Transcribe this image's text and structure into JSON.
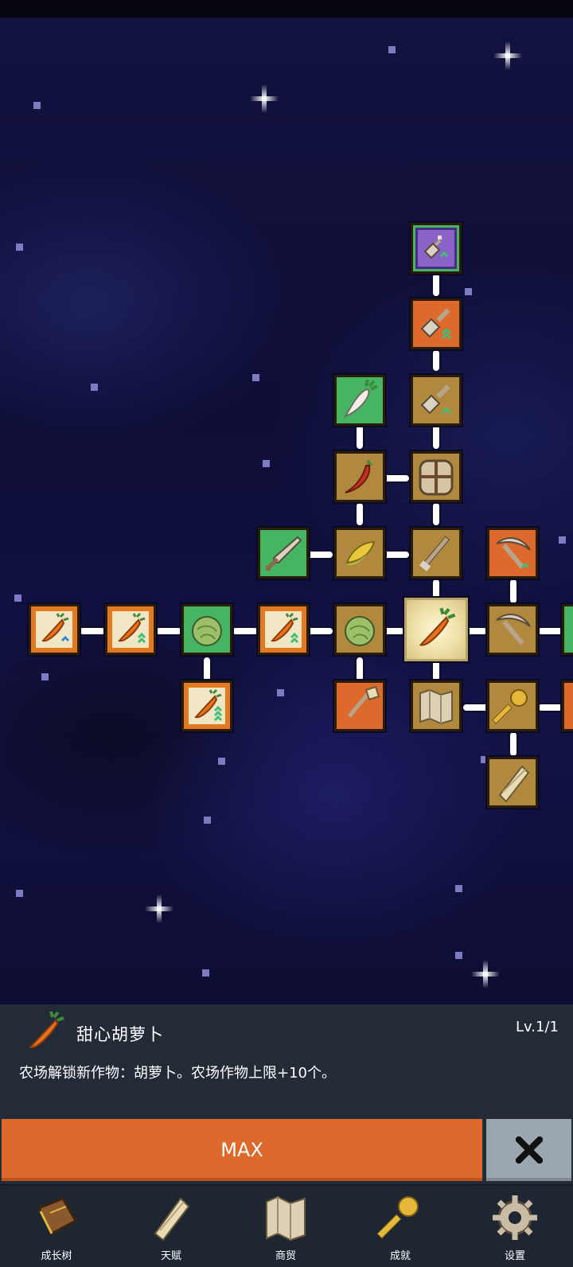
{
  "game": {
    "screen": "skill-tree",
    "selected_skill": {
      "name": "甜心胡萝卜",
      "level": "Lv.1/1",
      "description": "农场解锁新作物：胡萝卜。农场作物上限+10个。",
      "icon": "carrot-icon"
    },
    "max_button_label": "MAX",
    "close_button_icon": "close-icon"
  },
  "tree_nodes": [
    {
      "id": "shovel-purple",
      "icon": "shovel-icon",
      "color": "green",
      "badge": "up"
    },
    {
      "id": "shovel-orange",
      "icon": "shovel-icon",
      "color": "orange",
      "badge": "double-up"
    },
    {
      "id": "shovel-gold",
      "icon": "shovel-icon",
      "color": "gold",
      "badge": "up"
    },
    {
      "id": "radish",
      "icon": "radish-icon",
      "color": "green"
    },
    {
      "id": "chili",
      "icon": "chili-icon",
      "color": "gold"
    },
    {
      "id": "backpack",
      "icon": "backpack-icon",
      "color": "gold"
    },
    {
      "id": "sword",
      "icon": "sword-icon",
      "color": "green"
    },
    {
      "id": "corn",
      "icon": "corn-icon",
      "color": "gold"
    },
    {
      "id": "rake",
      "icon": "rake-icon",
      "color": "gold"
    },
    {
      "id": "pickaxe-orange",
      "icon": "pickaxe-icon",
      "color": "orange",
      "badge": "up"
    },
    {
      "id": "carrot-1",
      "icon": "carrot-icon",
      "color": "carrot",
      "badge": "up"
    },
    {
      "id": "carrot-2",
      "icon": "carrot-icon",
      "color": "carrot",
      "badge": "double-up"
    },
    {
      "id": "cabbage-1",
      "icon": "cabbage-icon",
      "color": "green"
    },
    {
      "id": "carrot-3",
      "icon": "carrot-icon",
      "color": "carrot",
      "badge": "double-up"
    },
    {
      "id": "cabbage-2",
      "icon": "cabbage-icon",
      "color": "gold"
    },
    {
      "id": "carrot-selected",
      "icon": "carrot-icon",
      "color": "selected"
    },
    {
      "id": "pickaxe-gold",
      "icon": "pickaxe-icon",
      "color": "gold"
    },
    {
      "id": "carrot-4",
      "icon": "carrot-icon",
      "color": "carrot",
      "badge": "triple-up"
    },
    {
      "id": "broom",
      "icon": "broom-icon",
      "color": "orange"
    },
    {
      "id": "map",
      "icon": "map-icon",
      "color": "gold"
    },
    {
      "id": "key",
      "icon": "key-icon",
      "color": "gold"
    },
    {
      "id": "scroll",
      "icon": "scroll-icon",
      "color": "gold"
    }
  ],
  "nav": [
    {
      "id": "growth",
      "label": "成长树",
      "icon": "book-icon"
    },
    {
      "id": "talent",
      "label": "天赋",
      "icon": "scroll-icon"
    },
    {
      "id": "trade",
      "label": "商贸",
      "icon": "map-icon"
    },
    {
      "id": "achievement",
      "label": "成就",
      "icon": "key-icon"
    },
    {
      "id": "settings",
      "label": "设置",
      "icon": "gear-icon"
    }
  ],
  "colors": {
    "sky": "#0f0f3a",
    "panel": "#232b36",
    "max_button": "#dd6a2c",
    "close_button": "#9aa7b1",
    "node_gold": "#b0893e",
    "node_orange": "#dd6a2c",
    "node_green": "#45b564"
  }
}
